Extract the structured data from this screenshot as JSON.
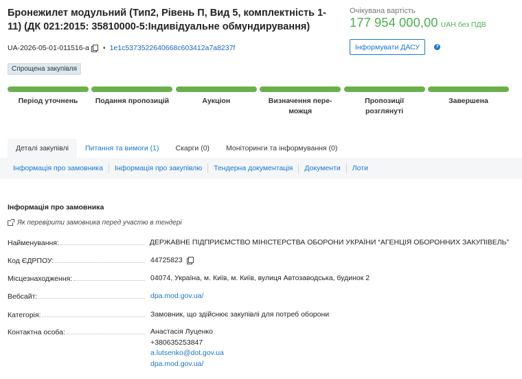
{
  "header": {
    "title": "Бронежилет модульний (Тип2, Рівень П, Вид 5, комплектність 1-11) (ДК 021:2015: 35810000-5:Індивідуальне обмундирування)",
    "budget_label": "Очікувана вартість",
    "budget_amount": "177 954 000,00",
    "budget_currency": "UAH без ПДВ",
    "tender_id": "UA-2026-05-01-011516-a",
    "separator": "•",
    "hash": "1e1c5373522640668c603412a7a8237f",
    "notify_button": "Інформувати ДАСУ",
    "help": "?",
    "procedure_badge": "Спрощена закупівля"
  },
  "stages": [
    {
      "label": "Період уточнень"
    },
    {
      "label": "Подання пропозицій"
    },
    {
      "label": "Аукціон"
    },
    {
      "label": "Визначення пере-можця"
    },
    {
      "label": "Пропозиції розглянуті"
    },
    {
      "label": "Завершена"
    }
  ],
  "stage_color": "#6ab04c",
  "tabs": [
    {
      "label": "Деталі закупівлі"
    },
    {
      "label": "Питання та вимоги (1)"
    },
    {
      "label": "Скарги (0)"
    },
    {
      "label": "Моніторинги та інформування (0)"
    }
  ],
  "subnav": [
    {
      "label": "Інформація про замовника"
    },
    {
      "label": "Інформація про закупівлю"
    },
    {
      "label": "Тендерна документація"
    },
    {
      "label": "Документи"
    },
    {
      "label": "Лоти"
    }
  ],
  "customer": {
    "section_title": "Інформація про замовника",
    "check_link": "Як перевірити замовника перед участю в тендері",
    "name_label": "Найменування:",
    "name_value": "ДЕРЖАВНЕ ПІДПРИЄМСТВО МІНІСТЕРСТВА ОБОРОНИ УКРАЇНИ “АГЕНЦІЯ ОБОРОННИХ ЗАКУПІВЕЛЬ”",
    "edrpou_label": "Код ЄДРПОУ:",
    "edrpou_value": "44725823",
    "location_label": "Місцезнаходження:",
    "location_value": "04074, Україна, м. Київ, м. Київ, вулиця Автозаводська, будинок 2",
    "website_label": "Вебсайт:",
    "website_value": "dpa.mod.gov.ua/",
    "category_label": "Категорія:",
    "category_value": "Замовник, що здійснює закупівлі для потреб оборони",
    "contact_label": "Контактна особа:",
    "contact_name": "Анастасія Луценко",
    "contact_phone": "+380635253847",
    "contact_email": "a.lutsenko@dot.gov.ua",
    "contact_site": "dpa.mod.gov.ua/"
  },
  "colors": {
    "accent_green": "#4caf50",
    "link_blue": "#1976d2"
  }
}
